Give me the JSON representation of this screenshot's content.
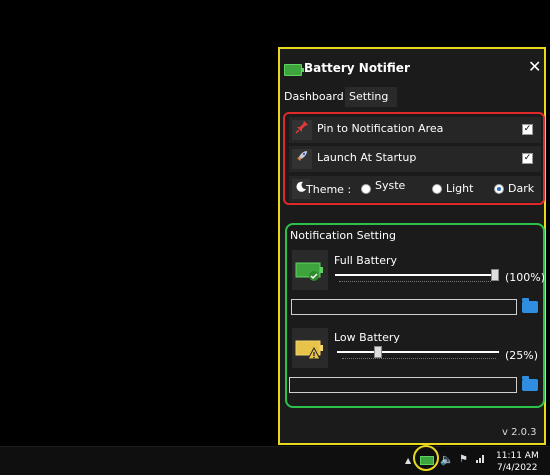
{
  "window": {
    "title": "Battery Notifier",
    "close_label": "✕",
    "tabs": [
      {
        "label": "Dashboard"
      },
      {
        "label": "Setting"
      }
    ],
    "options": {
      "pin_label": "Pin to Notification Area",
      "pin_checked": true,
      "startup_label": "Launch At Startup",
      "startup_checked": true,
      "theme_label": "Theme :",
      "themes": [
        {
          "label": "Syste",
          "selected": false
        },
        {
          "label": "Light",
          "selected": false
        },
        {
          "label": "Dark",
          "selected": true
        }
      ]
    },
    "notification": {
      "title": "Notification Setting",
      "full": {
        "label": "Full Battery",
        "percent_text": "(100%)",
        "value": 1.0,
        "path": ""
      },
      "low": {
        "label": "Low Battery",
        "percent_text": "(25%)",
        "value": 0.25,
        "path": ""
      }
    },
    "version": "v 2.0.3"
  },
  "taskbar": {
    "time": "11:11 AM",
    "date": "7/4/2022"
  },
  "colors": {
    "window_border": "#e8d81e",
    "options_border": "#e02a2a",
    "notification_border": "#2cc24a",
    "battery_green": "#3ea53e",
    "folder_blue": "#2f8ee0"
  }
}
